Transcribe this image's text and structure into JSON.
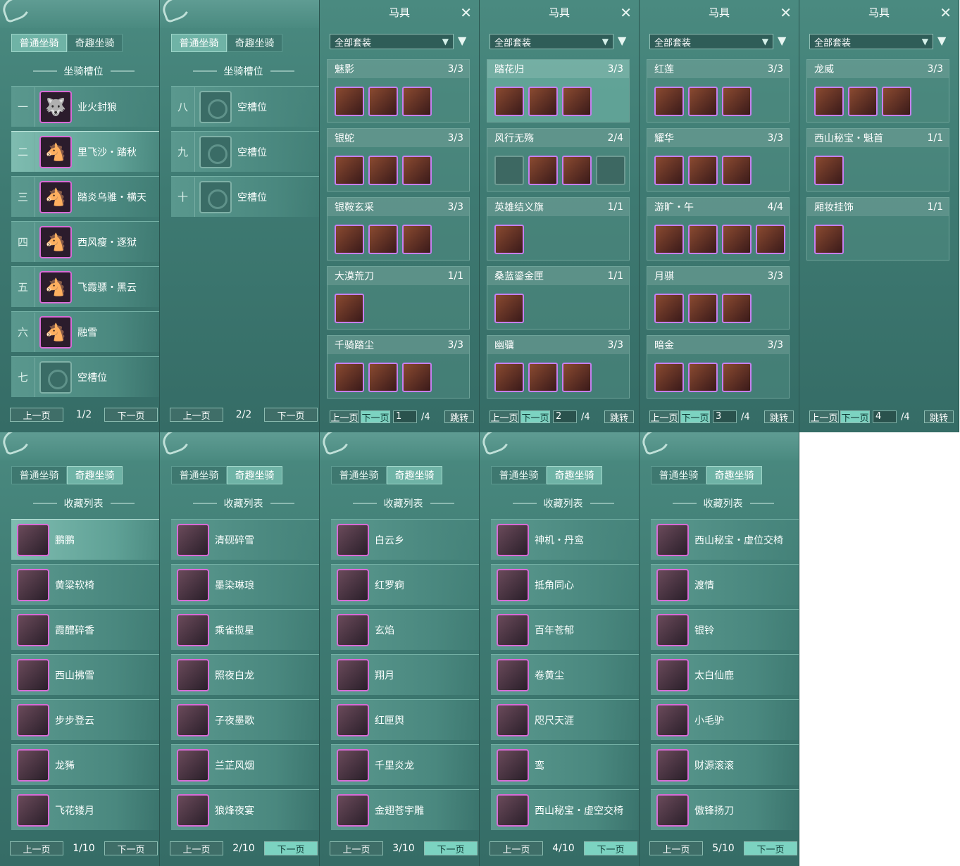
{
  "colors": {
    "panel": "#3e7a72",
    "tab_active": "#6fb3a6",
    "thumb_border": "#d86bd6",
    "page_btn_highlight": "#7cd3c1"
  },
  "tabs": [
    "普通坐骑",
    "奇趣坐骑"
  ],
  "slot_header": "坐骑槽位",
  "collection_header": "收藏列表",
  "pager": {
    "prev": "上一页",
    "next": "下一页",
    "jump": "跳转"
  },
  "slot_panels": [
    {
      "page": "1/2",
      "rows": [
        {
          "num": "一",
          "name": "业火封狼",
          "icon": "wolf-icon"
        },
        {
          "num": "二",
          "name": "里飞沙・踏秋",
          "icon": "horse-icon"
        },
        {
          "num": "三",
          "name": "踏炎乌骓・横天",
          "icon": "horse-icon"
        },
        {
          "num": "四",
          "name": "西风瘦・逐狱",
          "icon": "horse-icon"
        },
        {
          "num": "五",
          "name": "飞霞骠・黑云",
          "icon": "horse-icon"
        },
        {
          "num": "六",
          "name": "融雪",
          "icon": "horse-icon"
        },
        {
          "num": "七",
          "name": "空槽位",
          "icon": "empty-slot-icon"
        }
      ]
    },
    {
      "page": "2/2",
      "rows": [
        {
          "num": "八",
          "name": "空槽位",
          "icon": "empty-slot-icon"
        },
        {
          "num": "九",
          "name": "空槽位",
          "icon": "empty-slot-icon"
        },
        {
          "num": "十",
          "name": "空槽位",
          "icon": "empty-slot-icon"
        }
      ]
    }
  ],
  "gear_title": "马具",
  "gear_filter": "全部套装",
  "gear_panels": [
    {
      "page": "1",
      "total": "/4",
      "sets": [
        {
          "name": "魅影",
          "count": "3/3",
          "items": 3
        },
        {
          "name": "银蛇",
          "count": "3/3",
          "items": 3
        },
        {
          "name": "银鞍玄采",
          "count": "3/3",
          "items": 3
        },
        {
          "name": "大漠荒刀",
          "count": "1/1",
          "items": 1
        },
        {
          "name": "千骑踏尘",
          "count": "3/3",
          "items": 3
        }
      ]
    },
    {
      "page": "2",
      "total": "/4",
      "sets": [
        {
          "name": "踏花归",
          "count": "3/3",
          "items": 3
        },
        {
          "name": "风行无殇",
          "count": "2/4",
          "items": 4
        },
        {
          "name": "英雄结义旗",
          "count": "1/1",
          "items": 1
        },
        {
          "name": "桑蓝鎏金匣",
          "count": "1/1",
          "items": 1
        },
        {
          "name": "幽骥",
          "count": "3/3",
          "items": 3
        }
      ]
    },
    {
      "page": "3",
      "total": "/4",
      "sets": [
        {
          "name": "红莲",
          "count": "3/3",
          "items": 3
        },
        {
          "name": "耀华",
          "count": "3/3",
          "items": 3
        },
        {
          "name": "游旷・午",
          "count": "4/4",
          "items": 4
        },
        {
          "name": "月骐",
          "count": "3/3",
          "items": 3
        },
        {
          "name": "暗金",
          "count": "3/3",
          "items": 3
        }
      ]
    },
    {
      "page": "4",
      "total": "/4",
      "sets": [
        {
          "name": "龙威",
          "count": "3/3",
          "items": 3
        },
        {
          "name": "西山秘宝・魁首",
          "count": "1/1",
          "items": 1
        },
        {
          "name": "厢妆挂饰",
          "count": "1/1",
          "items": 1
        }
      ]
    }
  ],
  "collection_panels": [
    {
      "page": "1/10",
      "rows": [
        "鹏鹏",
        "黄粱软椅",
        "霞醴碎香",
        "西山拂雪",
        "步步登云",
        "龙豨",
        "飞花镂月"
      ]
    },
    {
      "page": "2/10",
      "rows": [
        "清砚碎雪",
        "墨染琳琅",
        "乘雀揽星",
        "照夜白龙",
        "子夜墨歌",
        "兰芷风烟",
        "狼烽夜宴"
      ]
    },
    {
      "page": "3/10",
      "rows": [
        "白云乡",
        "红罗痾",
        "玄焰",
        "翔月",
        "红匣舆",
        "千里炎龙",
        "金翅苍宇雕"
      ]
    },
    {
      "page": "4/10",
      "rows": [
        "神机・丹鸾",
        "抵角同心",
        "百年苍郁",
        "卷黄尘",
        "咫尺天涯",
        "鸾",
        "西山秘宝・虚空交椅"
      ]
    },
    {
      "page": "5/10",
      "rows": [
        "西山秘宝・虚位交椅",
        "渡情",
        "银铃",
        "太白仙鹿",
        "小毛驴",
        "财源滚滚",
        "傲锋扬刀"
      ]
    }
  ]
}
